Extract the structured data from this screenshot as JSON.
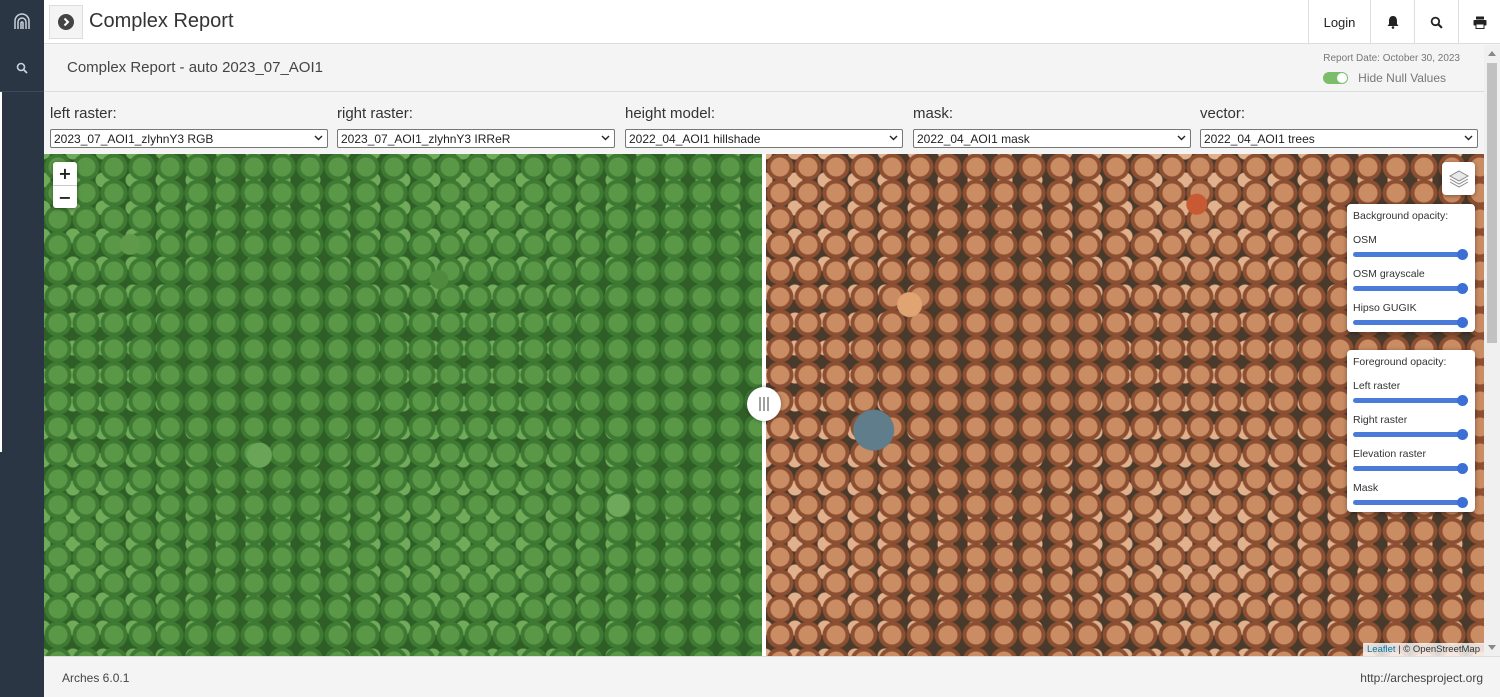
{
  "app": {
    "title": "Complex Report"
  },
  "topbar": {
    "login_label": "Login"
  },
  "report": {
    "title": "Complex Report - auto 2023_07_AOI1",
    "date": "Report Date: October 30, 2023",
    "hide_null_label": "Hide Null Values",
    "hide_null_on": true
  },
  "selectors": [
    {
      "label": "left raster:",
      "value": "2023_07_AOI1_zlyhnY3 RGB"
    },
    {
      "label": "right raster:",
      "value": "2023_07_AOI1_zlyhnY3 IRReR"
    },
    {
      "label": "height model:",
      "value": "2022_04_AOI1 hillshade"
    },
    {
      "label": "mask:",
      "value": "2022_04_AOI1 mask"
    },
    {
      "label": "vector:",
      "value": "2022_04_AOI1 trees"
    }
  ],
  "map": {
    "zoom_in": "+",
    "zoom_out": "−",
    "background_panel": {
      "title": "Background opacity:",
      "sliders": [
        {
          "label": "OSM",
          "value": 1.0
        },
        {
          "label": "OSM grayscale",
          "value": 1.0
        },
        {
          "label": "Hipso GUGIK",
          "value": 1.0
        }
      ]
    },
    "foreground_panel": {
      "title": "Foreground opacity:",
      "sliders": [
        {
          "label": "Left raster",
          "value": 1.0
        },
        {
          "label": "Right raster",
          "value": 1.0
        },
        {
          "label": "Elevation raster",
          "value": 1.0
        },
        {
          "label": "Mask",
          "value": 1.0
        }
      ]
    },
    "attribution": {
      "leaflet": "Leaflet",
      "sep": " | ",
      "osm": "© OpenStreetMap"
    }
  },
  "footer": {
    "version": "Arches 6.0.1",
    "site": "http://archesproject.org"
  },
  "colors": {
    "nav_bg": "#2b3645",
    "toggle_green": "#7cbd6c",
    "slider_blue": "#4a7bd8"
  }
}
